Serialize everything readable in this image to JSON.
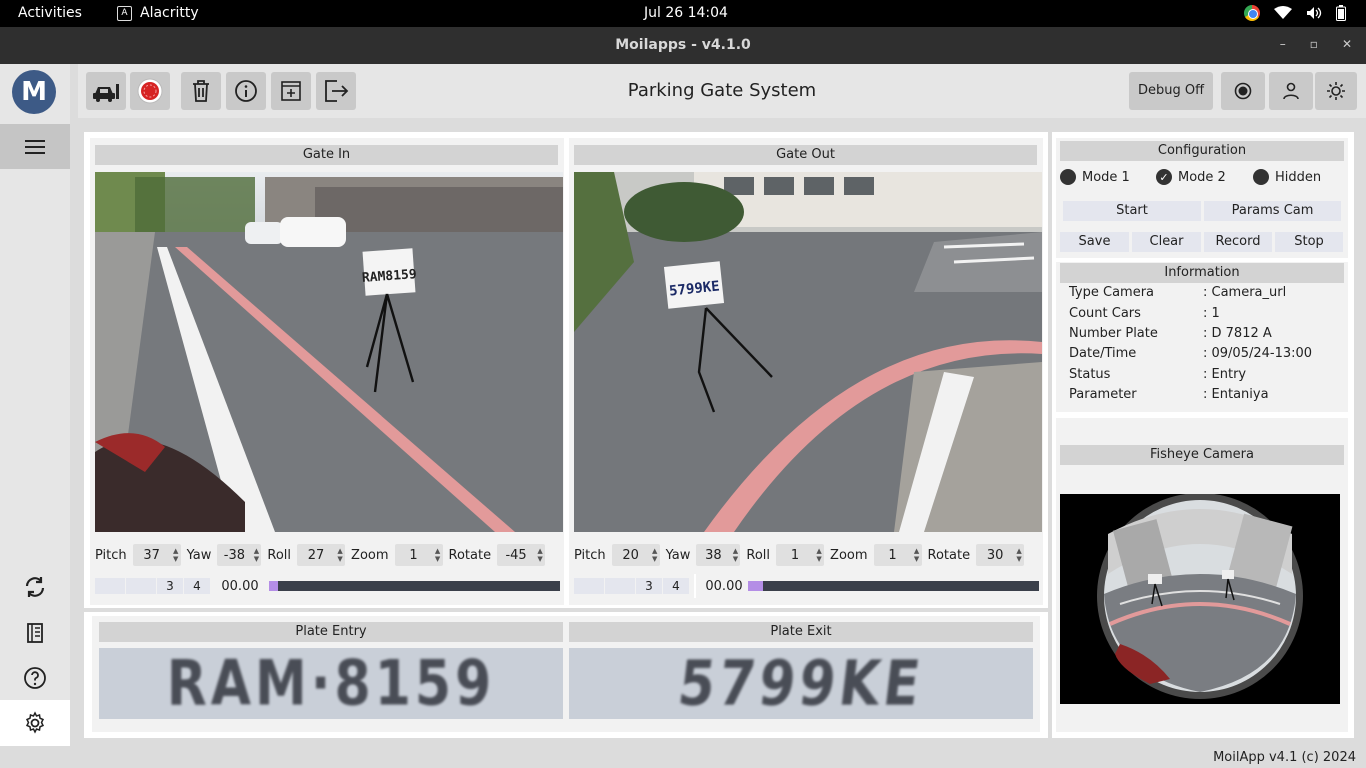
{
  "topbar": {
    "activities": "Activities",
    "app_name": "Alacritty",
    "clock": "Jul 26  14:04"
  },
  "window": {
    "title": "Moilapps - v4.1.0",
    "controls": [
      "–",
      "▫",
      "✕"
    ]
  },
  "header": {
    "page_title": "Parking Gate System",
    "debug_label": "Debug Off"
  },
  "gate_in": {
    "title": "Gate In",
    "plate_on_stand": "RAM8159",
    "controls": {
      "pitch_label": "Pitch",
      "pitch": "37",
      "yaw_label": "Yaw",
      "yaw": "-38",
      "roll_label": "Roll",
      "roll": "27",
      "zoom_label": "Zoom",
      "zoom": "1",
      "rotate_label": "Rotate",
      "rotate": "-45"
    },
    "boxes": [
      "",
      "",
      "3",
      "4"
    ],
    "time": "00.00",
    "progress": 0.03
  },
  "gate_out": {
    "title": "Gate Out",
    "plate_on_stand": "5799KE",
    "controls": {
      "pitch_label": "Pitch",
      "pitch": "20",
      "yaw_label": "Yaw",
      "yaw": "38",
      "roll_label": "Roll",
      "roll": "1",
      "zoom_label": "Zoom",
      "zoom": "1",
      "rotate_label": "Rotate",
      "rotate": "30"
    },
    "boxes": [
      "",
      "",
      "3",
      "4"
    ],
    "time": "00.00",
    "progress": 0.05
  },
  "plates": {
    "entry_title": "Plate Entry",
    "entry_text": "RAM·8159",
    "exit_title": "Plate Exit",
    "exit_text": "5799KE"
  },
  "configuration": {
    "title": "Configuration",
    "modes": [
      {
        "label": "Mode 1",
        "checked": false
      },
      {
        "label": "Mode 2",
        "checked": true
      },
      {
        "label": "Hidden",
        "checked": false
      }
    ],
    "start": "Start",
    "params_cam": "Params Cam",
    "save": "Save",
    "clear": "Clear",
    "record": "Record",
    "stop": "Stop"
  },
  "information": {
    "title": "Information",
    "rows": [
      {
        "key": "Type Camera",
        "value": ": Camera_url"
      },
      {
        "key": "Count Cars",
        "value": ": 1"
      },
      {
        "key": "Number Plate",
        "value": ": D 7812 A"
      },
      {
        "key": "Date/Time",
        "value": ": 09/05/24-13:00"
      },
      {
        "key": "Status",
        "value": ": Entry"
      },
      {
        "key": "Parameter",
        "value": ": Entaniya"
      }
    ]
  },
  "fisheye": {
    "title": "Fisheye Camera"
  },
  "footer": "MoilApp v4.1 (c) 2024",
  "colors": {
    "progress_fill": "#b48ee6",
    "progress_track": "#3a3f4a",
    "road_line": "#e29a9a"
  }
}
